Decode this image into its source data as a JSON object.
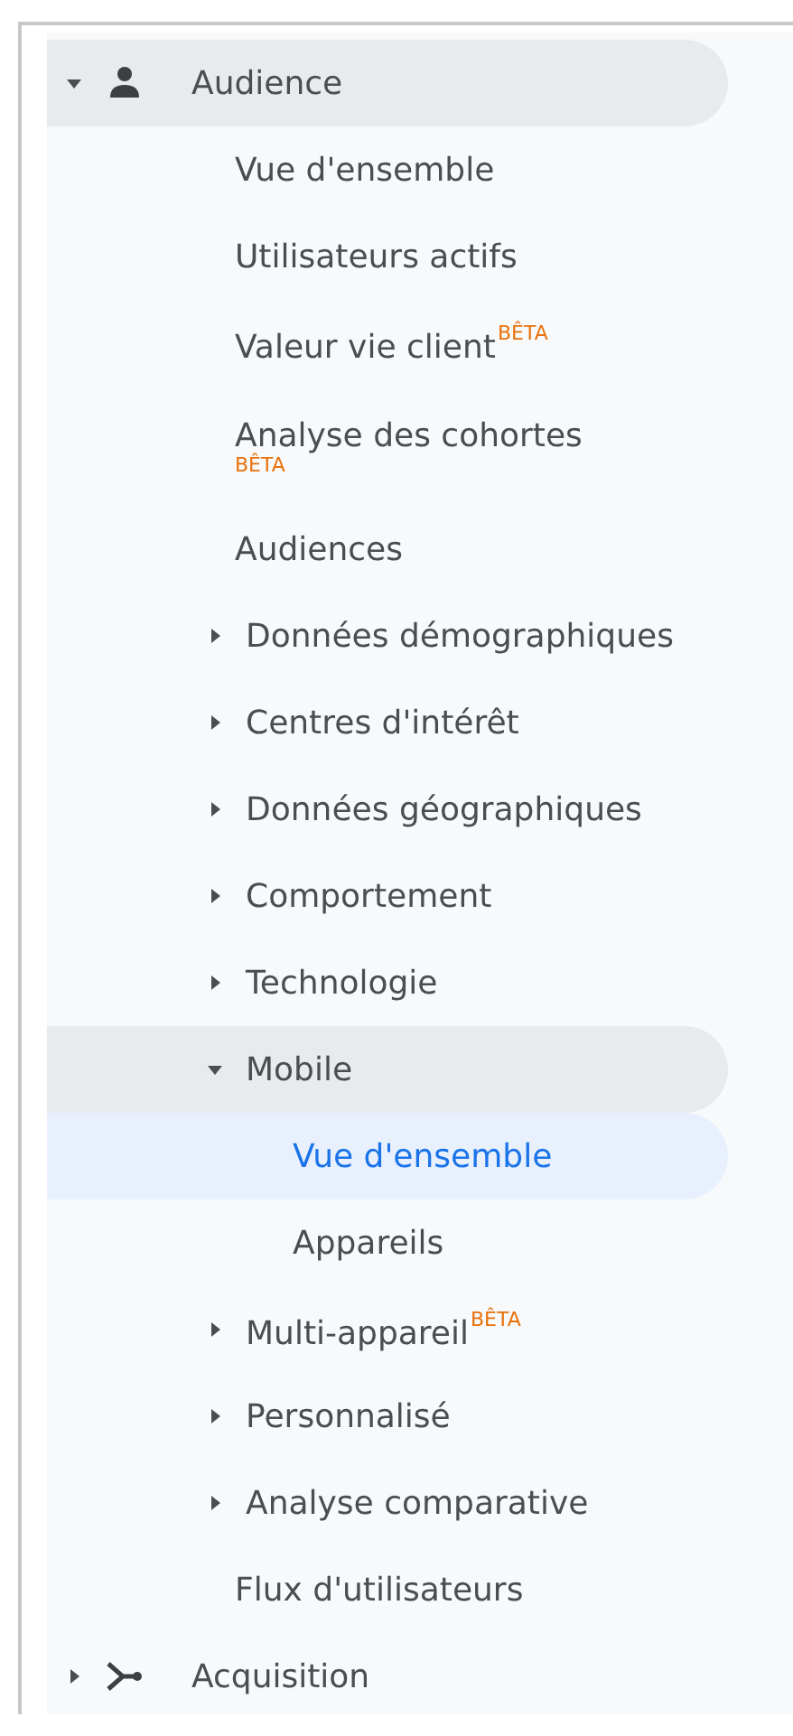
{
  "nav": [
    {
      "label": "Audience",
      "expanded": true,
      "selected": false,
      "children": [
        {
          "label": "Vue d'ensemble",
          "selected": false
        },
        {
          "label": "Utilisateurs actifs",
          "selected": false
        },
        {
          "label": "Valeur vie client$^{BÊTA}$",
          "selected": false
        },
        {
          "label": "Analyse des cohortes",
          "selected": false,
          "badge": "BÊTA"
        },
        {
          "label": "Audiences",
          "selected": false
        },
        {
          "label": "Données démographiques",
          "selected": false,
          "expanded": false
        },
        {
          "label": "Centres d'intérêt",
          "selected": false,
          "expanded": false
        },
        {
          "label": "Données géographiques",
          "selected": false,
          "expanded": false
        },
        {
          "label": "Comportement",
          "selected": false,
          "expanded": false
        },
        {
          "label": "Technologie",
          "selected": false,
          "expanded": false
        },
        {
          "label": "Mobile",
          "selected": false,
          "expanded": true,
          "children": [
            {
              "label": "Vue d'ensemble",
              "selected": true
            },
            {
              "label": "Appareils",
              "selected": false
            }
          ]
        },
        {
          "label": "Multi-appareil$^{BÊTA}$",
          "selected": false,
          "expanded": false
        },
        {
          "label": "Personnalisé",
          "selected": false,
          "expanded": false
        },
        {
          "label": "Analyse comparative",
          "selected": false,
          "expanded": false
        },
        {
          "label": "Flux d'utilisateurs",
          "selected": false
        }
      ]
    },
    {
      "label": "Acquisition",
      "expanded": false,
      "selected": false
    }
  ]
}
